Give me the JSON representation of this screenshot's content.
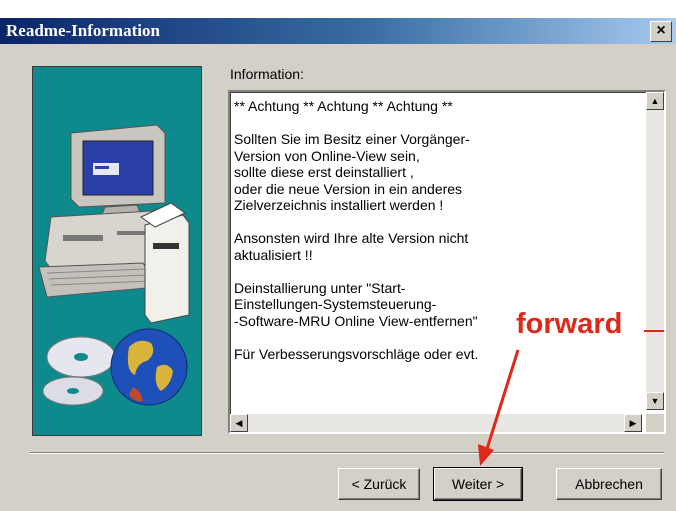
{
  "window": {
    "title": "Readme-Information",
    "close_label": "×"
  },
  "content": {
    "section_label": "Information:",
    "text": "** Achtung ** Achtung ** Achtung **\n\nSollten Sie im Besitz einer Vorgänger-\nVersion von Online-View sein,\nsollte diese erst deinstalliert ,\noder die neue Version in ein anderes\nZielverzeichnis installiert werden !\n\nAnsonsten wird Ihre alte Version nicht\naktualisiert !!\n\nDeinstallierung unter \"Start-\nEinstellungen-Systemsteuerung-\n-Software-MRU Online View-entfernen\"\n\nFür Verbesserungsvorschläge oder evt.",
    "scroll_up": "▲",
    "scroll_down": "▼",
    "scroll_left": "◀",
    "scroll_right": "▶"
  },
  "buttons": {
    "back": "< Zurück",
    "next": "Weiter >",
    "cancel": "Abbrechen"
  },
  "annotation": {
    "label": "forward",
    "color": "#e0271a"
  },
  "colors": {
    "titlebar_start": "#0a246a",
    "titlebar_end": "#a6caf0",
    "dialog_bg": "#d4d0c8",
    "illustration_bg": "#0f8a8c"
  },
  "icons": [
    "computer-illustration",
    "cd-disc-icon",
    "globe-icon",
    "close-icon"
  ]
}
